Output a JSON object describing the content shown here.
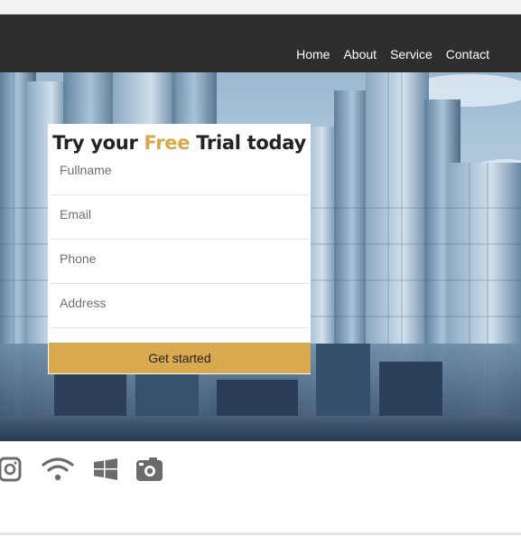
{
  "nav": {
    "links": [
      "Home",
      "About",
      "Service",
      "Contact"
    ]
  },
  "form": {
    "title_part1": "Try your ",
    "title_accent": "Free",
    "title_part2": " Trial today",
    "fields": {
      "fullname": "Fullname",
      "email": "Email",
      "phone": "Phone",
      "address": "Address"
    },
    "submit_label": "Get started"
  },
  "social_icons": [
    "instagram-icon",
    "wifi-icon",
    "windows-icon",
    "camera-icon"
  ],
  "colors": {
    "accent": "#d9a84b",
    "navbar": "#2f2d2d",
    "icon_gray": "#6b6b6b"
  }
}
